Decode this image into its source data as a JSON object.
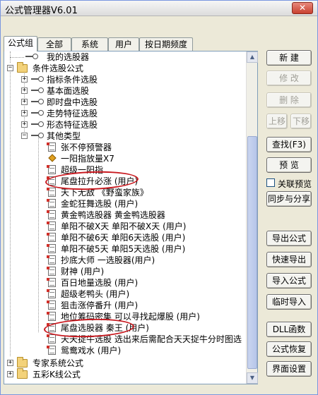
{
  "window": {
    "title": "公式管理器V6.01",
    "close_label": "✕"
  },
  "tabs": [
    {
      "label": "公式组"
    },
    {
      "label": "全部"
    },
    {
      "label": "系统"
    },
    {
      "label": "用户"
    },
    {
      "label": "按日期频度"
    }
  ],
  "tree": [
    {
      "label": "我的选股器",
      "icon": "key-icon"
    },
    {
      "label": "条件选股公式",
      "icon": "folder-icon",
      "expander": "−"
    },
    {
      "label": "指标条件选股",
      "icon": "key-icon",
      "expander": "+"
    },
    {
      "label": "基本面选股",
      "icon": "key-icon",
      "expander": "+"
    },
    {
      "label": "即时盘中选股",
      "icon": "key-icon",
      "expander": "+"
    },
    {
      "label": "走势特征选股",
      "icon": "key-icon",
      "expander": "+"
    },
    {
      "label": "形态特征选股",
      "icon": "key-icon",
      "expander": "+"
    },
    {
      "label": "其他类型",
      "icon": "key-icon",
      "expander": "−"
    },
    {
      "label": "张不停预警器",
      "icon": "doc-icon"
    },
    {
      "label": "一阳指放量X7",
      "icon": "diamond-icon"
    },
    {
      "label": "超级一阳指",
      "icon": "doc-icon"
    },
    {
      "label": "尾盘拉升必涨   (用户)",
      "icon": "doc-icon"
    },
    {
      "label": "天下无敌   《野蛮家族》",
      "icon": "doc-icon"
    },
    {
      "label": "金蛇狂舞选股   (用户)",
      "icon": "doc-icon"
    },
    {
      "label": "黄金鸭选股器   黄金鸭选股器",
      "icon": "doc-icon"
    },
    {
      "label": "单阳不破X天   单阳不破X天 (用户)",
      "icon": "doc-icon"
    },
    {
      "label": "单阳不破6天   单阳6天选股 (用户)",
      "icon": "doc-icon"
    },
    {
      "label": "单阳不破5天   单阳5天选股 (用户)",
      "icon": "doc-icon"
    },
    {
      "label": "抄底大师   一选股器(用户)",
      "icon": "doc-icon"
    },
    {
      "label": "财神   (用户)",
      "icon": "doc-icon"
    },
    {
      "label": "百日地量选股   (用户)",
      "icon": "doc-icon"
    },
    {
      "label": "超级老鸭头   (用户)",
      "icon": "doc-icon"
    },
    {
      "label": "狙击涨停番升   (用户)",
      "icon": "doc-icon"
    },
    {
      "label": "地位筹码密集   可以寻找起爆股 (用户)",
      "icon": "doc-icon"
    },
    {
      "label": "尾盘选股器   秦王 (用户)",
      "icon": "doc-icon"
    },
    {
      "label": "天天捉牛选股   选出来后需配合天天捉牛分时图选",
      "icon": "doc-icon"
    },
    {
      "label": "鸳鸯戏水   (用户)",
      "icon": "doc-icon"
    },
    {
      "label": "专家系统公式",
      "icon": "folder-icon",
      "expander": "+"
    },
    {
      "label": "五彩K线公式",
      "icon": "folder-icon",
      "expander": "+"
    }
  ],
  "buttons": {
    "new": "新  建",
    "modify": "修  改",
    "delete": "删  除",
    "move_up": "上移",
    "move_down": "下移",
    "find": "查找(F3)",
    "preview": "预  览",
    "linked_preview": "关联预览",
    "sync_share": "同步与分享",
    "export": "导出公式",
    "quick_export": "快速导出",
    "import": "导入公式",
    "temp_import": "临时导入",
    "dll": "DLL函数",
    "restore": "公式恢复",
    "ui_settings": "界面设置"
  },
  "scrollbar": {
    "up_arrow": "▲",
    "down_arrow": "▼"
  }
}
